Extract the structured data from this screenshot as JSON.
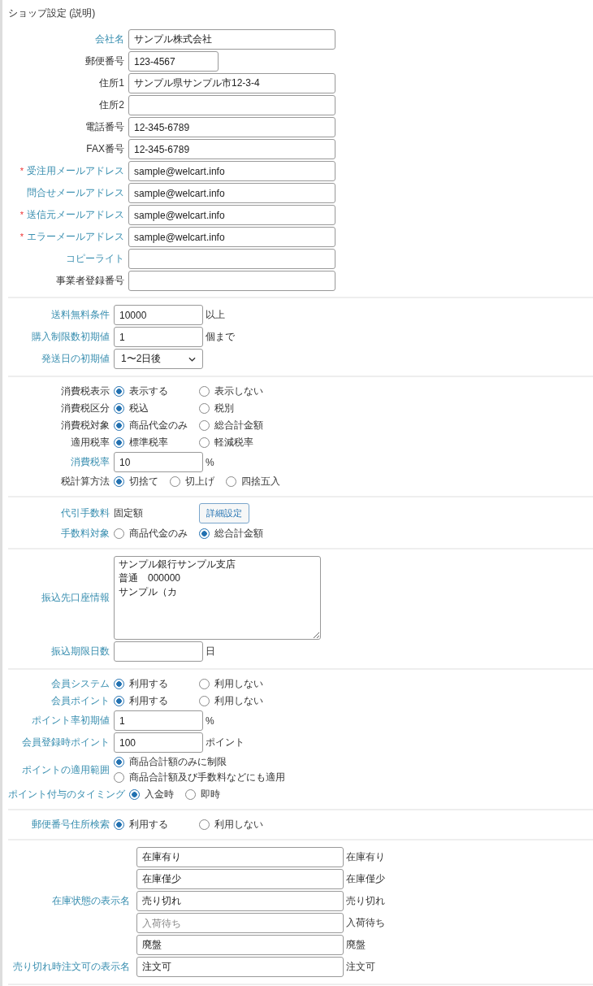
{
  "title": "ショップ設定 (説明)",
  "sections": [
    {
      "rows": [
        {
          "kind": "input",
          "label": "会社名",
          "link": true,
          "value": "サンプル株式会社"
        },
        {
          "kind": "short",
          "label": "郵便番号",
          "link": false,
          "value": "123-4567"
        },
        {
          "kind": "input",
          "label": "住所1",
          "link": false,
          "value": "サンプル県サンプル市12-3-4"
        },
        {
          "kind": "input",
          "label": "住所2",
          "link": false
        },
        {
          "kind": "input",
          "label": "電話番号",
          "link": false,
          "value": "12-345-6789"
        },
        {
          "kind": "input",
          "label": "FAX番号",
          "link": false,
          "value": "12-345-6789"
        },
        {
          "kind": "input",
          "label": "受注用メールアドレス",
          "link": true,
          "required_mark": "*",
          "value": "sample@welcart.info"
        },
        {
          "kind": "input",
          "label": "問合せメールアドレス",
          "link": true,
          "value": "sample@welcart.info"
        },
        {
          "kind": "input",
          "label": "送信元メールアドレス",
          "link": true,
          "required_mark": "*",
          "value": "sample@welcart.info"
        },
        {
          "kind": "input",
          "label": "エラーメールアドレス",
          "link": true,
          "required_mark": "*",
          "value": "sample@welcart.info"
        },
        {
          "kind": "input",
          "label": "コピーライト",
          "link": true
        },
        {
          "kind": "input",
          "label": "事業者登録番号",
          "link": false
        }
      ]
    },
    {
      "rows": [
        {
          "kind": "small",
          "label": "送料無料条件",
          "link": true,
          "value": "10000",
          "suffix": "以上"
        },
        {
          "kind": "small",
          "label": "購入制限数初期値",
          "link": true,
          "value": "1",
          "suffix": "個まで"
        },
        {
          "kind": "select",
          "label": "発送日の初期値",
          "link": true,
          "value": "1〜2日後"
        }
      ]
    },
    {
      "rows": [
        {
          "kind": "radio",
          "label": "消費税表示",
          "link": false,
          "options": [
            {
              "text": "表示する",
              "selected": true
            },
            {
              "text": "表示しない",
              "selected": false
            }
          ]
        },
        {
          "kind": "radio",
          "label": "消費税区分",
          "link": false,
          "options": [
            {
              "text": "税込",
              "selected": true
            },
            {
              "text": "税別",
              "selected": false
            }
          ]
        },
        {
          "kind": "radio",
          "label": "消費税対象",
          "link": false,
          "options": [
            {
              "text": "商品代金のみ",
              "selected": true
            },
            {
              "text": "総合計金額",
              "selected": false
            }
          ]
        },
        {
          "kind": "radio",
          "label": "適用税率",
          "link": false,
          "options": [
            {
              "text": "標準税率",
              "selected": true
            },
            {
              "text": "軽減税率",
              "selected": false
            }
          ]
        },
        {
          "kind": "small",
          "label": "消費税率",
          "link": true,
          "value": "10",
          "suffix": "%"
        },
        {
          "kind": "radio-compact",
          "label": "税計算方法",
          "link": false,
          "options": [
            {
              "text": "切捨て",
              "selected": true
            },
            {
              "text": "切上げ",
              "selected": false
            },
            {
              "text": "四捨五入",
              "selected": false
            }
          ]
        }
      ]
    },
    {
      "rows": [
        {
          "kind": "fee",
          "label": "代引手数料",
          "link": true,
          "text": "固定額",
          "button": "詳細設定"
        },
        {
          "kind": "radio",
          "label": "手数料対象",
          "link": true,
          "options": [
            {
              "text": "商品代金のみ",
              "selected": false
            },
            {
              "text": "総合計金額",
              "selected": true
            }
          ]
        }
      ]
    },
    {
      "rows": [
        {
          "kind": "textarea",
          "label": "振込先口座情報",
          "link": true,
          "lines": [
            "サンプル銀行サンプル支店",
            "普通　000000",
            "サンプル（カ"
          ]
        },
        {
          "kind": "small",
          "label": "振込期限日数",
          "link": true,
          "suffix": "日"
        }
      ]
    },
    {
      "rows": [
        {
          "kind": "radio",
          "label": "会員システム",
          "link": true,
          "options": [
            {
              "text": "利用する",
              "selected": true
            },
            {
              "text": "利用しない",
              "selected": false
            }
          ]
        },
        {
          "kind": "radio",
          "label": "会員ポイント",
          "link": true,
          "options": [
            {
              "text": "利用する",
              "selected": true
            },
            {
              "text": "利用しない",
              "selected": false
            }
          ]
        },
        {
          "kind": "small",
          "label": "ポイント率初期値",
          "link": true,
          "value": "1",
          "suffix": "%"
        },
        {
          "kind": "small",
          "label": "会員登録時ポイント",
          "link": true,
          "value": "100",
          "suffix": "ポイント"
        },
        {
          "kind": "radio-stack",
          "label": "ポイントの適用範囲",
          "link": true,
          "options": [
            {
              "text": "商品合計額のみに制限",
              "selected": true
            },
            {
              "text": "商品合計額及び手数料などにも適用",
              "selected": false
            }
          ]
        },
        {
          "kind": "radio-compact",
          "label": "ポイント付与のタイミング",
          "link": true,
          "options": [
            {
              "text": "入金時",
              "selected": true
            },
            {
              "text": "即時",
              "selected": false
            }
          ]
        }
      ]
    },
    {
      "rows": [
        {
          "kind": "radio",
          "label": "郵便番号住所検索",
          "link": true,
          "options": [
            {
              "text": "利用する",
              "selected": true
            },
            {
              "text": "利用しない",
              "selected": false
            }
          ]
        }
      ]
    },
    {
      "rows": [
        {
          "kind": "inputs",
          "label": "在庫状態の表示名",
          "link": true,
          "items": [
            {
              "value": "在庫有り",
              "suffix": "在庫有り"
            },
            {
              "value": "在庫僅少",
              "suffix": "在庫僅少"
            },
            {
              "value": "売り切れ",
              "suffix": "売り切れ"
            },
            {
              "placeholder": "入荷待ち",
              "suffix": "入荷待ち"
            },
            {
              "value": "廃盤",
              "suffix": "廃盤"
            }
          ]
        },
        {
          "kind": "inputs",
          "label": "売り切れ時注文可の表示名",
          "link": true,
          "items": [
            {
              "value": "注文可",
              "suffix": "注文可"
            }
          ]
        }
      ]
    }
  ]
}
